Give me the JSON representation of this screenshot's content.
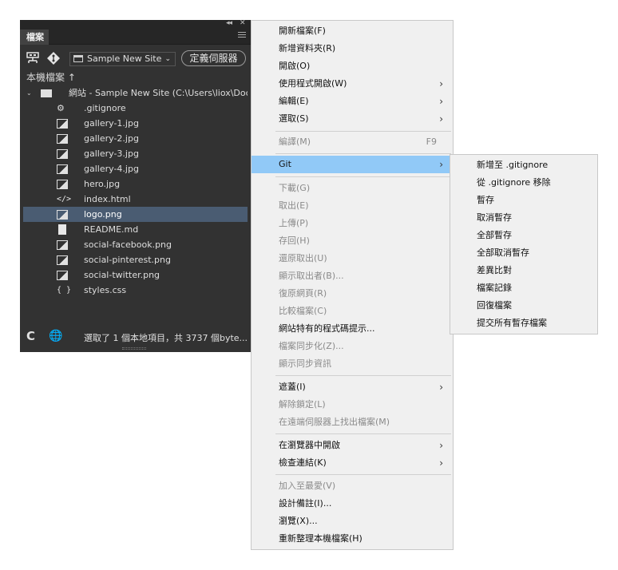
{
  "panel": {
    "tab_label": "檔案",
    "collapse_glyph": "◂◂",
    "close_glyph": "✕",
    "site_select": {
      "value": "Sample New Site",
      "chevron": "⌄"
    },
    "define_server_button": "定義伺服器",
    "local_files_label": "本機檔案 ↑",
    "root": {
      "expander": "⌄",
      "label": "網站 - Sample New Site (C:\\Users\\liox\\Docu..."
    },
    "files": [
      {
        "name": ".gitignore",
        "icon": "settings-file-icon"
      },
      {
        "name": "gallery-1.jpg",
        "icon": "image-file-icon"
      },
      {
        "name": "gallery-2.jpg",
        "icon": "image-file-icon"
      },
      {
        "name": "gallery-3.jpg",
        "icon": "image-file-icon"
      },
      {
        "name": "gallery-4.jpg",
        "icon": "image-file-icon"
      },
      {
        "name": "hero.jpg",
        "icon": "image-file-icon"
      },
      {
        "name": "index.html",
        "icon": "code-file-icon",
        "glyph": "</>"
      },
      {
        "name": "logo.png",
        "icon": "image-file-icon",
        "selected": true
      },
      {
        "name": "README.md",
        "icon": "document-file-icon"
      },
      {
        "name": "social-facebook.png",
        "icon": "image-file-icon"
      },
      {
        "name": "social-pinterest.png",
        "icon": "image-file-icon"
      },
      {
        "name": "social-twitter.png",
        "icon": "image-file-icon"
      },
      {
        "name": "styles.css",
        "icon": "css-file-icon",
        "glyph": "{ }"
      }
    ],
    "status": {
      "refresh_glyph": "C",
      "globe_glyph": "🌐",
      "message": "選取了 1 個本地項目，共 3737 個byte..."
    },
    "selected_color": "#4a5c72"
  },
  "menu": {
    "items": [
      {
        "label": "開新檔案(F)"
      },
      {
        "label": "新增資料夾(R)"
      },
      {
        "label": "開啟(O)"
      },
      {
        "label": "使用程式開啟(W)",
        "submenu": true
      },
      {
        "label": "編輯(E)",
        "submenu": true
      },
      {
        "label": "選取(S)",
        "submenu": true
      },
      {
        "separator": true
      },
      {
        "label": "編譯(M)",
        "shortcut": "F9",
        "disabled": true
      },
      {
        "separator": true
      },
      {
        "label": "Git",
        "submenu": true,
        "highlighted": true
      },
      {
        "separator": true
      },
      {
        "label": "下載(G)",
        "disabled": true
      },
      {
        "label": "取出(E)",
        "disabled": true
      },
      {
        "label": "上傳(P)",
        "disabled": true
      },
      {
        "label": "存回(H)",
        "disabled": true
      },
      {
        "label": "還原取出(U)",
        "disabled": true
      },
      {
        "label": "顯示取出者(B)...",
        "disabled": true
      },
      {
        "label": "復原網頁(R)",
        "disabled": true
      },
      {
        "label": "比較檔案(C)",
        "disabled": true
      },
      {
        "label": "網站特有的程式碼提示..."
      },
      {
        "label": "檔案同步化(Z)...",
        "disabled": true
      },
      {
        "label": "顯示同步資訊",
        "disabled": true
      },
      {
        "separator": true
      },
      {
        "label": "遮蓋(I)",
        "submenu": true
      },
      {
        "label": "解除鎖定(L)",
        "disabled": true
      },
      {
        "label": "在遠端伺服器上找出檔案(M)",
        "disabled": true
      },
      {
        "separator": true
      },
      {
        "label": "在瀏覽器中開啟",
        "submenu": true
      },
      {
        "label": "檢查連結(K)",
        "submenu": true
      },
      {
        "separator": true
      },
      {
        "label": "加入至最愛(V)",
        "disabled": true
      },
      {
        "label": "設計備註(I)..."
      },
      {
        "label": "瀏覽(X)..."
      },
      {
        "label": "重新整理本機檔案(H)"
      }
    ],
    "arrow_glyph": "›",
    "highlight_color": "#91c9f7"
  },
  "git_submenu": {
    "items": [
      {
        "label": "新增至 .gitignore"
      },
      {
        "label": "從 .gitignore 移除"
      },
      {
        "label": "暫存"
      },
      {
        "label": "取消暫存"
      },
      {
        "label": "全部暫存"
      },
      {
        "label": "全部取消暫存"
      },
      {
        "label": "差異比對"
      },
      {
        "label": "檔案記錄"
      },
      {
        "label": "回復檔案"
      },
      {
        "label": "提交所有暫存檔案"
      }
    ]
  }
}
